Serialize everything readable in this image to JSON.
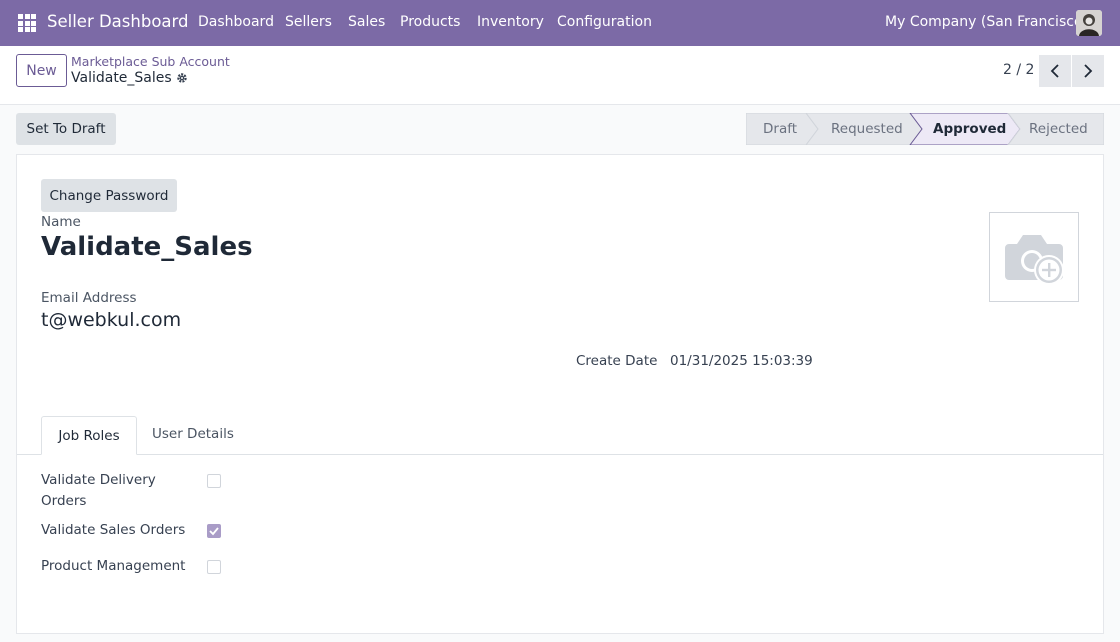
{
  "navbar": {
    "app_title": "Seller Dashboard",
    "menu": [
      "Dashboard",
      "Sellers",
      "Sales",
      "Products",
      "Inventory",
      "Configuration"
    ],
    "company": "My Company (San Francisco)"
  },
  "control": {
    "new_label": "New",
    "breadcrumb": "Marketplace Sub Account",
    "record_title": "Validate_Sales",
    "pager": "2 / 2"
  },
  "statusbar": {
    "set_draft_label": "Set To Draft",
    "stages": [
      "Draft",
      "Requested",
      "Approved",
      "Rejected"
    ],
    "active_stage": "Approved"
  },
  "form": {
    "change_password_label": "Change Password",
    "name_label": "Name",
    "name_value": "Validate_Sales",
    "email_label": "Email Address",
    "email_value": "t@webkul.com",
    "create_date_label": "Create Date",
    "create_date_value": "01/31/2025 15:03:39"
  },
  "tabs": [
    "Job Roles",
    "User Details"
  ],
  "job_roles": [
    {
      "label": "Validate Delivery Orders",
      "checked": false
    },
    {
      "label": "Validate Sales Orders",
      "checked": true
    },
    {
      "label": "Product Management",
      "checked": false
    }
  ],
  "colors": {
    "navbar": "#7c6aa6",
    "accent": "#6b5b95",
    "active_stage": "#ede9f6"
  }
}
